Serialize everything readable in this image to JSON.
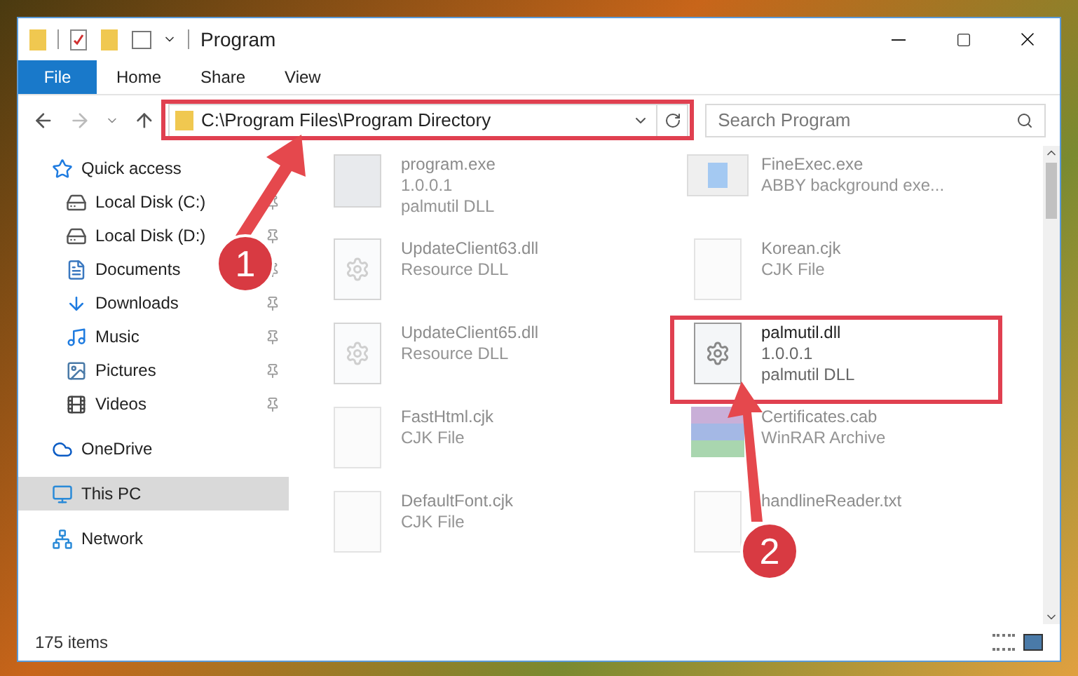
{
  "window": {
    "title": "Program"
  },
  "ribbon_tabs": [
    {
      "label": "File",
      "kind": "file"
    },
    {
      "label": "Home",
      "kind": "tab"
    },
    {
      "label": "Share",
      "kind": "tab"
    },
    {
      "label": "View",
      "kind": "tab"
    }
  ],
  "address_bar": {
    "path": "C:\\Program Files\\Program Directory"
  },
  "search": {
    "placeholder": "Search Program"
  },
  "sidebar": {
    "items": [
      {
        "label": "Quick access",
        "kind": "section",
        "pinned": false,
        "selected": false
      },
      {
        "label": "Local Disk (C:)",
        "kind": "item",
        "pinned": true,
        "selected": false
      },
      {
        "label": "Local Disk (D:)",
        "kind": "item",
        "pinned": true,
        "selected": false
      },
      {
        "label": "Documents",
        "kind": "item",
        "pinned": true,
        "selected": false
      },
      {
        "label": "Downloads",
        "kind": "item",
        "pinned": true,
        "selected": false
      },
      {
        "label": "Music",
        "kind": "item",
        "pinned": true,
        "selected": false
      },
      {
        "label": "Pictures",
        "kind": "item",
        "pinned": true,
        "selected": false
      },
      {
        "label": "Videos",
        "kind": "item",
        "pinned": true,
        "selected": false
      },
      {
        "label": "OneDrive",
        "kind": "section",
        "pinned": false,
        "selected": false
      },
      {
        "label": "This PC",
        "kind": "section",
        "pinned": false,
        "selected": true
      },
      {
        "label": "Network",
        "kind": "section",
        "pinned": false,
        "selected": false
      }
    ]
  },
  "files": [
    {
      "name": "program.exe",
      "details": [
        "1.0.0.1",
        "palmutil DLL"
      ],
      "kind": "app",
      "faded": true
    },
    {
      "name": "FineExec.exe",
      "details": [
        "ABBY background exe..."
      ],
      "kind": "window",
      "faded": true
    },
    {
      "name": "UpdateClient63.dll",
      "details": [
        "Resource DLL"
      ],
      "kind": "dll",
      "faded": true
    },
    {
      "name": "Korean.cjk",
      "details": [
        "CJK File"
      ],
      "kind": "blank",
      "faded": true
    },
    {
      "name": "UpdateClient65.dll",
      "details": [
        "Resource DLL"
      ],
      "kind": "dll",
      "faded": true
    },
    {
      "name": "palmutil.dll",
      "details": [
        "1.0.0.1",
        "palmutil DLL"
      ],
      "kind": "dll",
      "faded": false
    },
    {
      "name": "FastHtml.cjk",
      "details": [
        "CJK File"
      ],
      "kind": "blank",
      "faded": true
    },
    {
      "name": "Certificates.cab",
      "details": [
        "WinRAR Archive"
      ],
      "kind": "archive",
      "faded": true
    },
    {
      "name": "DefaultFont.cjk",
      "details": [
        "CJK File"
      ],
      "kind": "blank",
      "faded": true
    },
    {
      "name": "handlineReader.txt",
      "kind": "blank",
      "faded": true
    }
  ],
  "status_bar": {
    "item_count": "175 items"
  },
  "callouts": [
    {
      "number": "1"
    },
    {
      "number": "2"
    }
  ]
}
